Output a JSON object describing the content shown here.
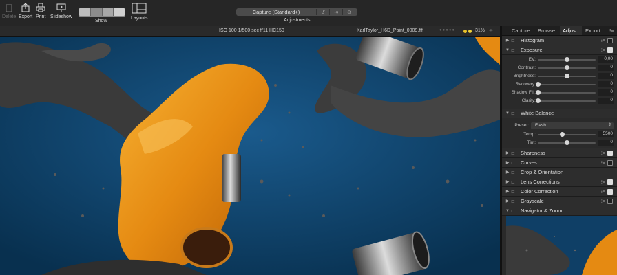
{
  "toolbar": {
    "delete_label": "Delete",
    "export_label": "Export",
    "print_label": "Print",
    "slideshow_label": "Slideshow",
    "show_label": "Show",
    "layouts_label": "Layouts",
    "adjustments_label": "Adjustments",
    "style_value": "Capture (Standard+)"
  },
  "infobar": {
    "metadata": "ISO 100  1/500 sec  f/11  HC150",
    "filename": "KarlTaylor_H6D_Paint_0009.fff",
    "rating_stars": "●●●●●",
    "zoom": "31%",
    "color_tags": [
      "#e8c22a",
      "#f0d23a"
    ]
  },
  "panel": {
    "tabs": [
      "Capture",
      "Browse",
      "Adjust",
      "Export"
    ],
    "active_tab": "Adjust",
    "tools": {
      "histogram": "Histogram",
      "exposure": "Exposure",
      "white_balance": "White Balance",
      "sharpness": "Sharpness",
      "curves": "Curves",
      "crop": "Crop & Orientation",
      "lens": "Lens Corrections",
      "color": "Color Correction",
      "grayscale": "Grayscale",
      "navigator": "Navigator & Zoom"
    },
    "exposure_sliders": [
      {
        "label": "EV:",
        "value": "0,00",
        "level": 0.5
      },
      {
        "label": "Contrast:",
        "value": "0",
        "level": 0.5
      },
      {
        "label": "Brightness:",
        "value": "0",
        "level": 0.5
      },
      {
        "label": "Recovery:",
        "value": "0",
        "level": 0.0
      },
      {
        "label": "Shadow Fill:",
        "value": "0",
        "level": 0.0
      },
      {
        "label": "Clarity:",
        "value": "0",
        "level": 0.0
      }
    ],
    "wb": {
      "preset_label": "Preset:",
      "preset_value": "Flash",
      "temp_label": "Temp:",
      "temp_value": "5500",
      "temp_level": 0.42,
      "tint_label": "Tint:",
      "tint_value": "0",
      "tint_level": 0.5
    }
  },
  "colors": {
    "background_blue": "#0d3a5f",
    "paint_orange": "#e8901a",
    "paint_grey": "#3a3a3a"
  }
}
